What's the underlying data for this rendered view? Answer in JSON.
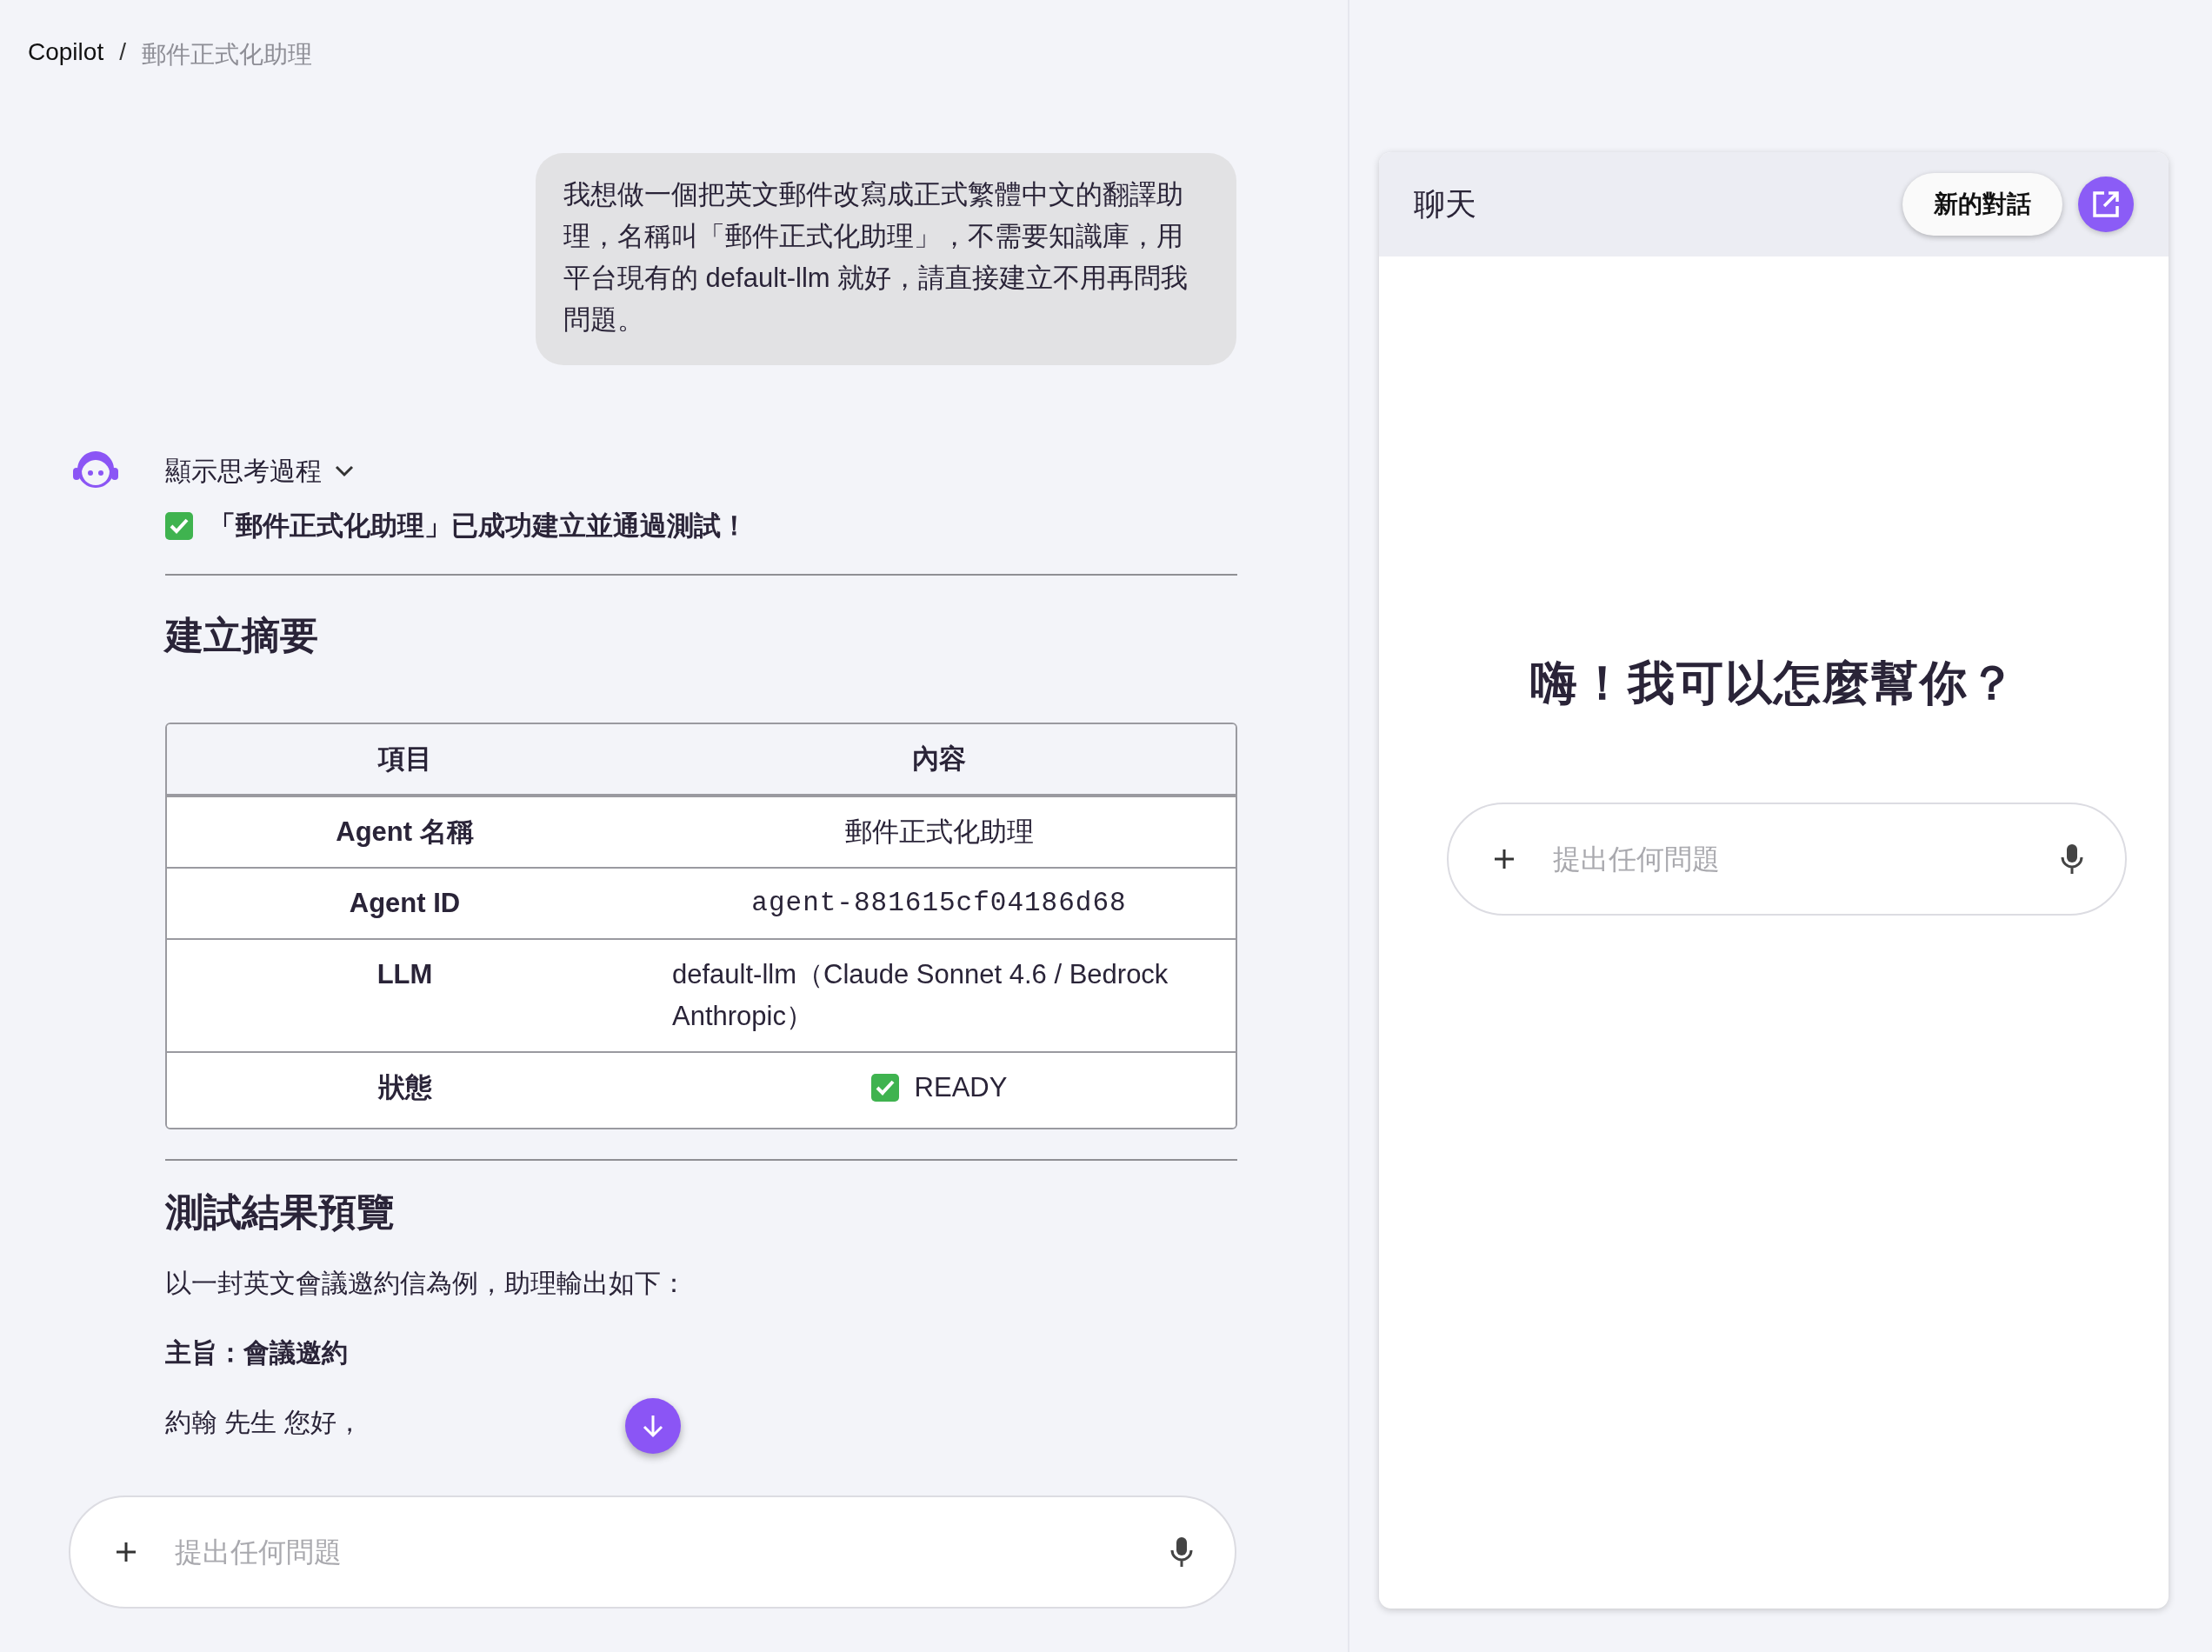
{
  "breadcrumb": [
    {
      "label": "Copilot",
      "current": false
    },
    {
      "label": "郵件正式化助理",
      "current": true
    }
  ],
  "breadcrumb_separator": "/",
  "user_message": "我想做一個把英文郵件改寫成正式繁體中文的翻譯助理，名稱叫「郵件正式化助理」，不需要知識庫，用平台現有的 default-llm 就好，請直接建立不用再問我問題。",
  "assistant": {
    "thinking_toggle": {
      "label": "顯示思考過程",
      "expanded": false
    },
    "success_line": "「郵件正式化助理」已成功建立並通過測試！",
    "summary_heading": "建立摘要",
    "table": {
      "columns": [
        "項目",
        "內容"
      ],
      "rows": [
        {
          "label": "Agent 名稱",
          "value": "郵件正式化助理",
          "kind": "text"
        },
        {
          "label": "Agent ID",
          "value": "agent-881615cf04186d68",
          "kind": "mono"
        },
        {
          "label": "LLM",
          "value": "default-llm（Claude Sonnet 4.6 / Bedrock Anthropic）",
          "kind": "wrap"
        },
        {
          "label": "狀態",
          "value": "READY",
          "kind": "status"
        }
      ]
    },
    "preview_heading": "測試結果預覽",
    "paragraphs": [
      {
        "text": "以一封英文會議邀約信為例，助理輸出如下：",
        "bold": false
      },
      {
        "text": "主旨：會議邀約",
        "bold": true
      },
      {
        "text": "約翰 先生 您好，",
        "bold": false
      }
    ]
  },
  "main_input": {
    "placeholder": "提出任何問題"
  },
  "chat_panel": {
    "title": "聊天",
    "new_chat_button": "新的對話",
    "greeting": "嗨！我可以怎麼幫你？",
    "input": {
      "placeholder": "提出任何問題"
    }
  }
}
